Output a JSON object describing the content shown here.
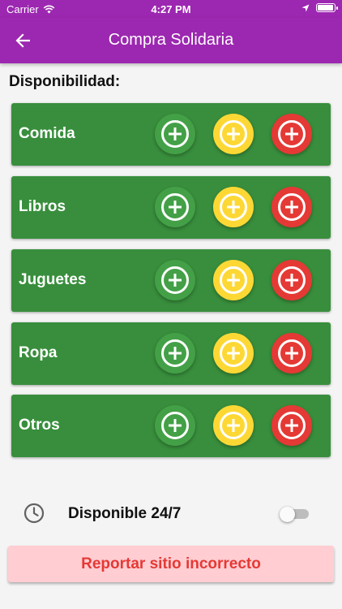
{
  "status_bar": {
    "carrier": "Carrier",
    "time": "4:27 PM"
  },
  "app_bar": {
    "title": "Compra Solidaria",
    "back_icon": "arrow-back-icon",
    "color": "#9c27b0"
  },
  "section_title": "Disponibilidad:",
  "categories": [
    {
      "label": "Comida"
    },
    {
      "label": "Libros"
    },
    {
      "label": "Juguetes"
    },
    {
      "label": "Ropa"
    },
    {
      "label": "Otros"
    }
  ],
  "level_buttons": [
    {
      "name": "green",
      "color": "#43a047",
      "icon": "add-circle-icon"
    },
    {
      "name": "yellow",
      "color": "#fdd835",
      "icon": "add-circle-icon"
    },
    {
      "name": "red",
      "color": "#e53935",
      "icon": "add-circle-icon"
    }
  ],
  "card_color": "#388e3c",
  "availability": {
    "label": "Disponible 24/7",
    "icon": "clock-icon",
    "toggle_on": false
  },
  "report_button": {
    "label": "Reportar sitio incorrecto",
    "bg": "#ffcdd2",
    "text_color": "#e53935"
  }
}
